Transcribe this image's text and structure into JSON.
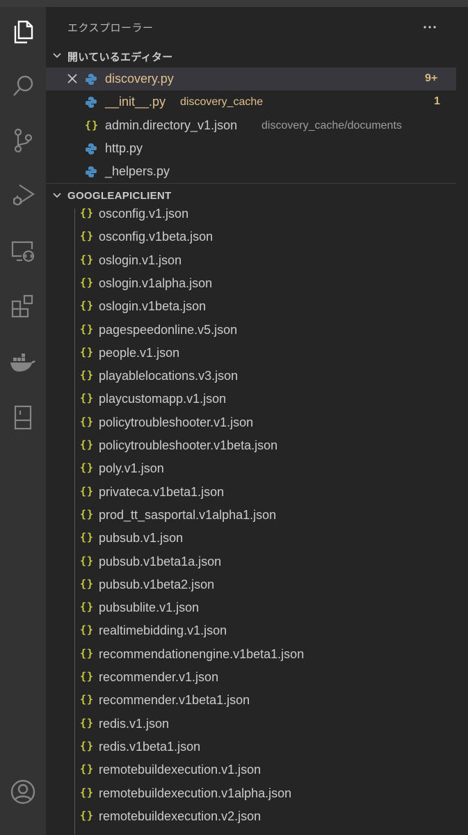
{
  "explorer": {
    "title": "エクスプローラー",
    "more_icon": "ellipsis-icon"
  },
  "open_editors": {
    "label": "開いているエディター",
    "items": [
      {
        "icon": "python-icon",
        "name": "discovery.py",
        "desc": "",
        "badge": "9+",
        "modified": true
      },
      {
        "icon": "python-icon",
        "name": "__init__.py",
        "desc": "discovery_cache",
        "badge": "1",
        "modified": true
      },
      {
        "icon": "json-icon",
        "name": "admin.directory_v1.json",
        "desc": "discovery_cache/documents",
        "badge": "",
        "modified": false
      },
      {
        "icon": "python-icon",
        "name": "http.py",
        "desc": "",
        "badge": "",
        "modified": false
      },
      {
        "icon": "python-icon",
        "name": "_helpers.py",
        "desc": "",
        "badge": "",
        "modified": false
      }
    ]
  },
  "folder": {
    "label": "GOOGLEAPICLIENT",
    "json_glyph": "{}",
    "files": [
      "osconfig.v1.json",
      "osconfig.v1beta.json",
      "oslogin.v1.json",
      "oslogin.v1alpha.json",
      "oslogin.v1beta.json",
      "pagespeedonline.v5.json",
      "people.v1.json",
      "playablelocations.v3.json",
      "playcustomapp.v1.json",
      "policytroubleshooter.v1.json",
      "policytroubleshooter.v1beta.json",
      "poly.v1.json",
      "privateca.v1beta1.json",
      "prod_tt_sasportal.v1alpha1.json",
      "pubsub.v1.json",
      "pubsub.v1beta1a.json",
      "pubsub.v1beta2.json",
      "pubsublite.v1.json",
      "realtimebidding.v1.json",
      "recommendationengine.v1beta1.json",
      "recommender.v1.json",
      "recommender.v1beta1.json",
      "redis.v1.json",
      "redis.v1beta1.json",
      "remotebuildexecution.v1.json",
      "remotebuildexecution.v1alpha.json",
      "remotebuildexecution.v2.json"
    ]
  },
  "activity_bar": [
    "explorer-icon",
    "search-icon",
    "source-control-icon",
    "run-debug-icon",
    "remote-explorer-icon",
    "extensions-icon",
    "docker-icon",
    "bookmark-panel-icon",
    "accounts-icon"
  ],
  "colors": {
    "modified": "#e2c08d",
    "badge": "#d7ba7d",
    "json_icon": "#cbcb41",
    "python_icon": "#4b8bbe"
  }
}
